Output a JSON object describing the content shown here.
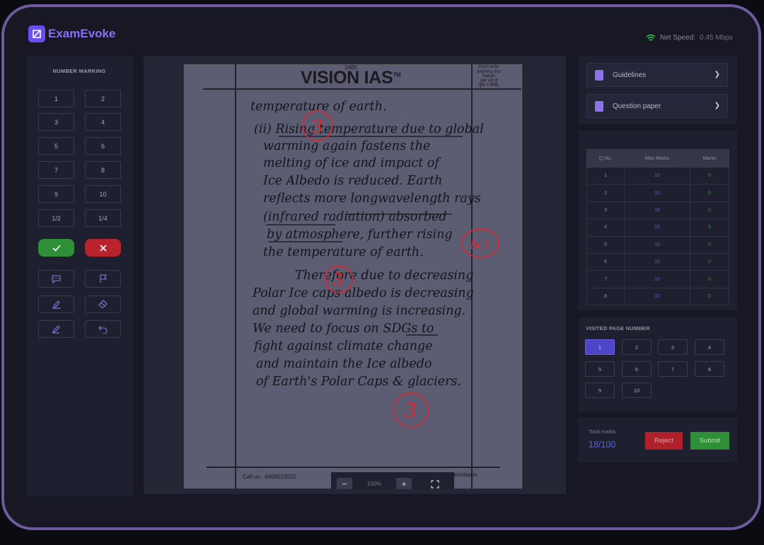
{
  "brand": {
    "name": "ExamEvoke"
  },
  "net_speed": {
    "label": "Net Speed:",
    "value": "0.45 Mbps"
  },
  "number_marking": {
    "title": "NUMBER MARKING",
    "buttons": [
      "1",
      "2",
      "3",
      "4",
      "5",
      "6",
      "7",
      "8",
      "9",
      "10",
      "1/2",
      "1/4"
    ]
  },
  "tools": {
    "correct_icon": "check-icon",
    "wrong_icon": "close-icon",
    "items": [
      "comment-icon",
      "flag-icon",
      "highlighter-icon",
      "eraser-icon",
      "pen-icon",
      "undo-icon"
    ]
  },
  "answer_sheet": {
    "page_number": "1485",
    "header": "VISION IAS",
    "trademark": "TM",
    "margin_note": [
      "Don't write",
      "anything this",
      "margin",
      "(इस भाग में",
      "कुछ न लिखें)"
    ],
    "footer_left": "Call us : 8468022022",
    "footer_right": "Visit us : www.visionias.in",
    "handwriting": [
      "temperature of earth.",
      "(ii) Rising temperature due to global",
      "warming again fastens the",
      "melting of ice and impact of",
      "Ice Albedo is reduced. Earth",
      "reflects more longwavelength rays",
      "(infrared radiation) absorbed",
      "by atmosphere, further rising",
      "the temperature of earth.",
      "Therefore due to decreasing",
      "Polar Ice caps albedo is decreasing",
      "and global warming is increasing.",
      "We need to focus on SDGs to",
      "fight against climate change",
      "and maintain the Ice albedo",
      "of Earth's Polar Caps & glaciers."
    ],
    "annotations": [
      "3",
      "N.I",
      "3",
      "3"
    ]
  },
  "zoom": {
    "minus": "−",
    "value": "100%",
    "plus": "+"
  },
  "sidebar": {
    "guidelines": "Guidelines",
    "question_paper": "Question paper"
  },
  "marks_table": {
    "headers": [
      "Q.No.",
      "Max Marks",
      "Marks"
    ],
    "rows": [
      [
        "1",
        "10",
        "9"
      ],
      [
        "2",
        "10",
        "9"
      ],
      [
        "3",
        "10",
        "0"
      ],
      [
        "4",
        "10",
        "9"
      ],
      [
        "5",
        "10",
        "0"
      ],
      [
        "6",
        "10",
        "0"
      ],
      [
        "7",
        "10",
        "0"
      ],
      [
        "8",
        "10",
        "0"
      ]
    ]
  },
  "visited_pages": {
    "title": "VISITED PAGE NUMBER",
    "pages": [
      "1",
      "2",
      "3",
      "4",
      "5",
      "6",
      "7",
      "8",
      "9",
      "10"
    ],
    "active": "1"
  },
  "totals": {
    "label": "Total marks",
    "value": "18/100"
  },
  "actions": {
    "reject": "Reject",
    "submit": "Submit"
  },
  "colors": {
    "accent": "#6d4ef0",
    "success": "#2f8f38",
    "danger": "#b8232d",
    "annotation": "#e0242e"
  }
}
